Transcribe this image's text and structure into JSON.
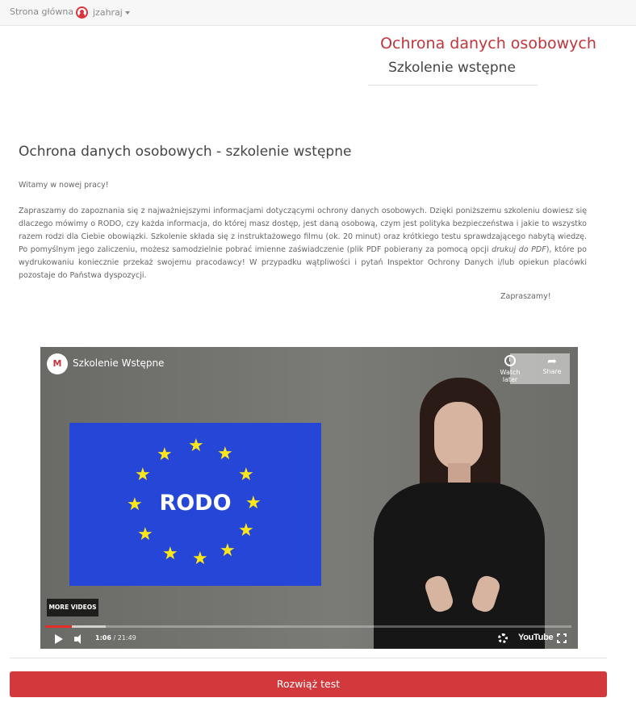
{
  "nav": {
    "home_label": "Strona główna",
    "user_label": "jzahraj"
  },
  "brand": {
    "title": "Ochrona danych osobowych",
    "subtitle": "Szkolenie wstępne"
  },
  "content": {
    "heading": "Ochrona danych osobowych - szkolenie wstępne",
    "greeting": "Witamy w nowej pracy!",
    "intro_part1": "Zapraszamy do zapoznania się z najważniejszymi informacjami dotyczącymi ochrony danych osobowych. Dzięki poniższemu szkoleniu dowiesz się dlaczego mówimy o RODO, czy każda informacja, do której masz dostęp, jest daną osobową, czym jest polityka bezpieczeństwa i jakie to wszystko razem rodzi dla Ciebie obowiązki. Szkolenie składa się z instruktażowego filmu (ok. 20 minut) oraz krótkiego testu sprawdzającego nabytą wiedzę. Po pomyślnym jego zaliczeniu, możesz samodzielnie pobrać imienne zaświadczenie (plik PDF pobierany za pomocą opcji ",
    "intro_em": "drukuj do PDF",
    "intro_part2": "), które po wydrukowaniu koniecznie przekaż swojemu pracodawcy! W przypadku wątpliwości i pytań Inspektor Ochrony Danych i/lub opiekun placówki pozostaje do Państwa dyspozycji.",
    "closing": "Zapraszamy!"
  },
  "video": {
    "title": "Szkolenie Wstępne",
    "channel_badge": "M",
    "flag_text": "RODO",
    "watch_later_label": "Watch later",
    "share_label": "Share",
    "more_videos_label": "MORE VIDEOS",
    "current_time": "1:06",
    "duration": "21:49",
    "youtube_label": "YouTube",
    "progress_played_fraction": 0.05,
    "progress_buffered_fraction": 0.115,
    "accent_color": "#e52d27",
    "flag_color": "#2546d6",
    "star_color": "#ffe619"
  },
  "actions": {
    "solve_test_label": "Rozwiąż test",
    "button_color": "#d1393c"
  }
}
